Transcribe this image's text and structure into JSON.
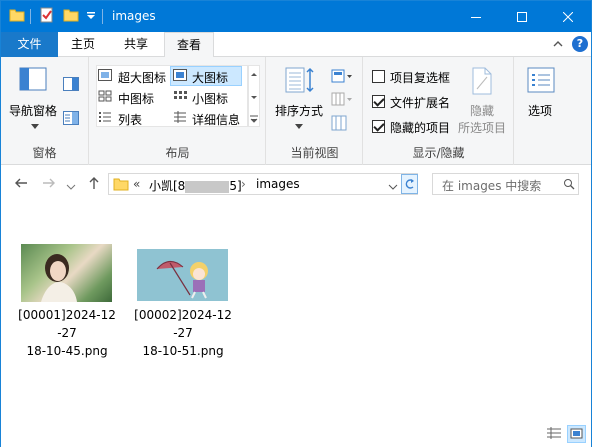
{
  "window": {
    "title": "images"
  },
  "tabs": {
    "file": "文件",
    "home": "主页",
    "share": "共享",
    "view": "查看"
  },
  "ribbon": {
    "nav_pane": "导航窗格",
    "group_panes": "窗格",
    "layout": {
      "extra_large": "超大图标",
      "large": "大图标",
      "medium": "中图标",
      "small": "小图标",
      "list": "列表",
      "details": "详细信息"
    },
    "group_layout": "布局",
    "sort": "排序方式",
    "group_current_view": "当前视图",
    "item_checkboxes": "项目复选框",
    "file_extensions": "文件扩展名",
    "hidden_items": "隐藏的项目",
    "hide_selected_1": "隐藏",
    "hide_selected_2": "所选项目",
    "options": "选项",
    "group_show_hide": "显示/隐藏",
    "checks": {
      "item_checkboxes": false,
      "file_extensions": true,
      "hidden_items": true
    }
  },
  "address": {
    "overflow": "«",
    "crumb_user": "小凯[8",
    "crumb_user_tail": "5]",
    "crumb_current": "images",
    "search_placeholder": "在 images 中搜索"
  },
  "files": [
    {
      "line1": "[00001]2024-12",
      "line2": "-27",
      "line3": "18-10-45.png"
    },
    {
      "line1": "[00002]2024-12",
      "line2": "-27",
      "line3": "18-10-51.png"
    }
  ],
  "colors": {
    "accent": "#0078d7",
    "file_tab": "#1979ca",
    "ribbon_bg": "#f5f6f7",
    "selected": "#cce8ff"
  }
}
